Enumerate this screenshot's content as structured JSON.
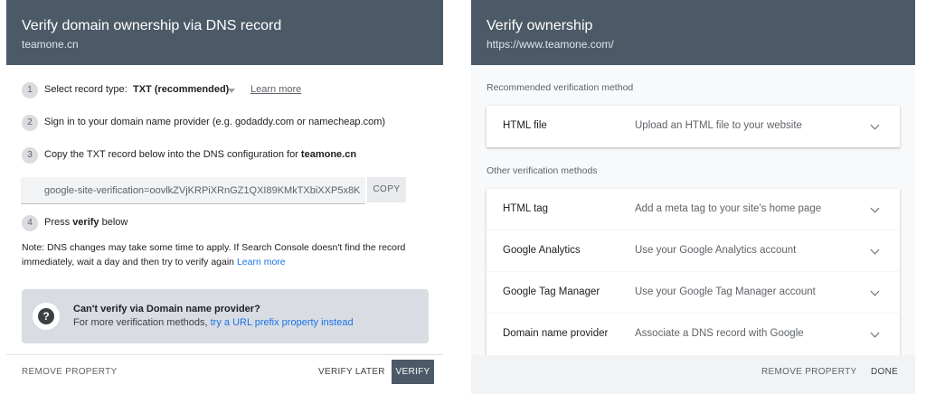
{
  "left_dialog": {
    "title": "Verify domain ownership via DNS record",
    "domain": "teamone.cn",
    "steps": [
      {
        "num": "1",
        "text": "Select record type:"
      },
      {
        "num": "2",
        "text": "Sign in to your domain name provider (e.g. godaddy.com or namecheap.com)"
      },
      {
        "num": "3",
        "text": "Copy the TXT record below into the DNS configuration for",
        "emph": "teamone.cn"
      },
      {
        "num": "4",
        "text_before": "Press",
        "emph": "verify",
        "text_after": "below"
      }
    ],
    "record_type": {
      "selected": "TXT (recommended)",
      "learn_more": "Learn more"
    },
    "txt_record": "google-site-verification=oovlkZVjKRPiXRnGZ1QXI89KMkTXbiXXP5x8K",
    "copy_label": "COPY",
    "note": "Note: DNS changes may take some time to apply. If Search Console doesn't find the record immediately, wait a day and then try to verify again",
    "note_link": "Learn more",
    "help": {
      "title": "Can't verify via Domain name provider?",
      "text": "For more verification methods,",
      "link": "try a URL prefix property instead"
    },
    "footer": {
      "remove": "REMOVE PROPERTY",
      "verify_later": "VERIFY LATER",
      "verify": "VERIFY"
    }
  },
  "right_dialog": {
    "title": "Verify ownership",
    "url": "https://www.teamone.com/",
    "recommended_label": "Recommended verification method",
    "recommended": {
      "name": "HTML file",
      "desc": "Upload an HTML file to your website"
    },
    "other_label": "Other verification methods",
    "others": [
      {
        "name": "HTML tag",
        "desc": "Add a meta tag to your site's home page"
      },
      {
        "name": "Google Analytics",
        "desc": "Use your Google Analytics account"
      },
      {
        "name": "Google Tag Manager",
        "desc": "Use your Google Tag Manager account"
      },
      {
        "name": "Domain name provider",
        "desc": "Associate a DNS record with Google"
      }
    ],
    "footer": {
      "remove": "REMOVE PROPERTY",
      "done": "DONE"
    }
  },
  "icons": {
    "help": "help-circle-icon",
    "expand": "chevron-down-icon",
    "dropdown": "dropdown-caret-icon"
  },
  "colors": {
    "header": "#4b5a66",
    "link": "#1a73e8",
    "help_card": "#d9dde3"
  }
}
